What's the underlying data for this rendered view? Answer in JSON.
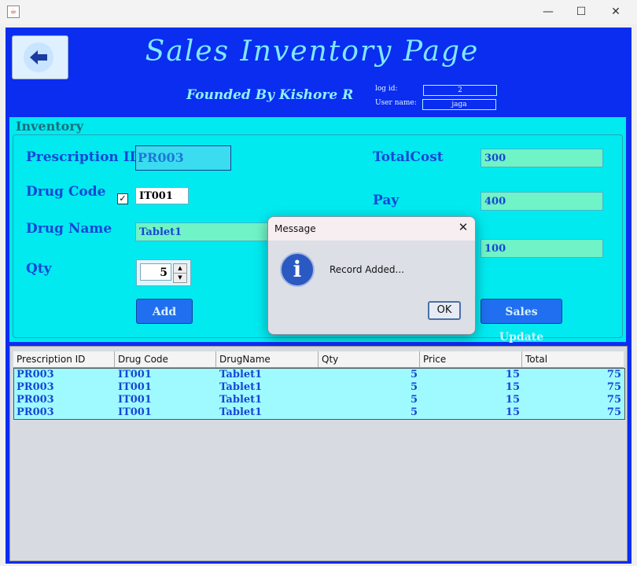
{
  "window": {
    "minimize": "—",
    "maximize": "☐",
    "close": "✕"
  },
  "header": {
    "title": "Sales Inventory Page",
    "founded": "Founded By Kishore R",
    "log_id_label": "log id:",
    "log_id_value": "2",
    "user_name_label": "User name:",
    "user_name_value": "jaga",
    "back_icon": "arrow-left-icon"
  },
  "inventory": {
    "title": "Inventory",
    "prescription_id_label": "Prescription ID",
    "prescription_id_value": "PR003",
    "drug_code_label": "Drug Code",
    "drug_code_value": "IT001",
    "drug_code_checked": "✓",
    "drug_name_label": "Drug Name",
    "drug_name_value": "Tablet1",
    "qty_label": "Qty",
    "qty_value": "5",
    "total_cost_label": "TotalCost",
    "total_cost_value": "300",
    "pay_label": "Pay",
    "pay_value": "400",
    "balance_value": "100",
    "add_button": "Add",
    "sales_update_button": "Sales Update"
  },
  "table": {
    "columns": [
      "Prescription ID",
      "Drug Code",
      "DrugName",
      "Qty",
      "Price",
      "Total"
    ],
    "rows": [
      [
        "PR003",
        "IT001",
        "Tablet1",
        "5",
        "15",
        "75"
      ],
      [
        "PR003",
        "IT001",
        "Tablet1",
        "5",
        "15",
        "75"
      ],
      [
        "PR003",
        "IT001",
        "Tablet1",
        "5",
        "15",
        "75"
      ],
      [
        "PR003",
        "IT001",
        "Tablet1",
        "5",
        "15",
        "75"
      ]
    ]
  },
  "dialog": {
    "title": "Message",
    "close": "✕",
    "message": "Record Added...",
    "ok": "OK"
  },
  "colors": {
    "frame": "#0a2df0",
    "panel": "#00eaf0",
    "field": "#70f3c6",
    "text_blue": "#1746d6"
  }
}
